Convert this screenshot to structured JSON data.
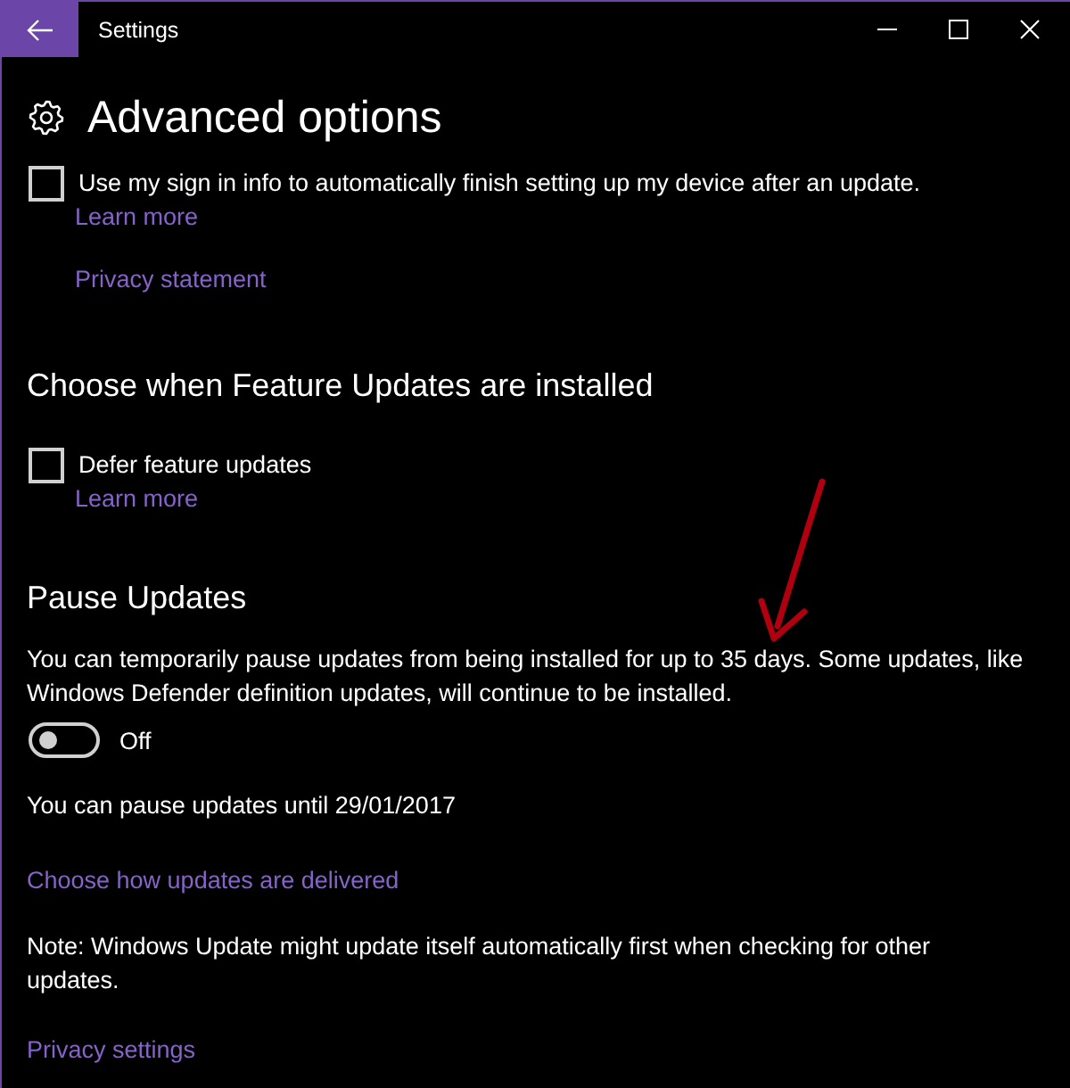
{
  "window": {
    "title": "Settings"
  },
  "page_title": "Advanced options",
  "sign_in_option": {
    "label": "Use my sign in info to automatically finish setting up my device after an update.",
    "checked": false,
    "link": "Learn more"
  },
  "privacy_statement_link": "Privacy statement",
  "feature_updates": {
    "heading": "Choose when Feature Updates are installed",
    "option": {
      "label": "Defer feature updates",
      "checked": false,
      "link": "Learn more"
    }
  },
  "pause_updates": {
    "heading": "Pause Updates",
    "description": "You can temporarily pause updates from being installed for up to 35 days. Some updates, like Windows Defender definition updates, will continue to be installed.",
    "toggle": {
      "on": false,
      "label": "Off"
    },
    "until_text": "You can pause updates until 29/01/2017"
  },
  "delivery_link": "Choose how updates are delivered",
  "note": "Note: Windows Update might update itself automatically first when checking for other updates.",
  "privacy_settings_link": "Privacy settings"
}
